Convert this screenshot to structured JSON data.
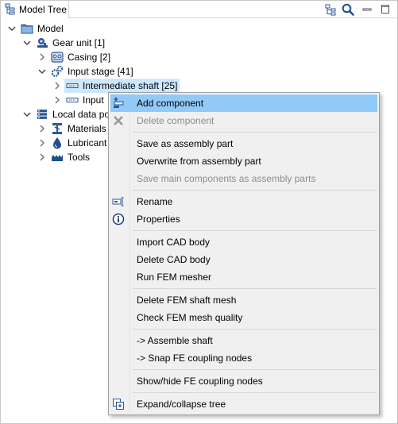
{
  "panel": {
    "tab_title": "Model Tree"
  },
  "toolbar": {
    "icons": [
      "link-tree-icon",
      "search-icon",
      "minimize-icon",
      "maximize-icon"
    ]
  },
  "tree": {
    "root": "Model",
    "gear_unit": "Gear unit [1]",
    "casing": "Casing [2]",
    "input_stage": "Input stage [41]",
    "intermediate_shaft": "Intermediate shaft [25]",
    "input_shaft": "Input",
    "local_data": "Local data po",
    "materials": "Materials",
    "lubricants": "Lubricant",
    "tools": "Tools"
  },
  "context_menu": {
    "add_component": "Add component",
    "delete_component": "Delete component",
    "save_as_assembly": "Save as assembly part",
    "overwrite_from_assembly": "Overwrite from assembly part",
    "save_main_components": "Save main components as assembly parts",
    "rename": "Rename",
    "properties": "Properties",
    "import_cad": "Import CAD body",
    "delete_cad": "Delete CAD body",
    "run_fem": "Run FEM mesher",
    "delete_fem_mesh": "Delete FEM shaft mesh",
    "check_fem_quality": "Check FEM mesh quality",
    "assemble_shaft": "->  Assemble shaft",
    "snap_fe": "->  Snap FE coupling nodes",
    "show_hide_fe": "Show/hide FE coupling nodes",
    "expand_collapse": "Expand/collapse tree"
  },
  "colors": {
    "selection": "#cce8ff",
    "menu_hover": "#91c9f7",
    "menu_bg": "#f0f0f0",
    "disabled_text": "#8c8c8c"
  }
}
